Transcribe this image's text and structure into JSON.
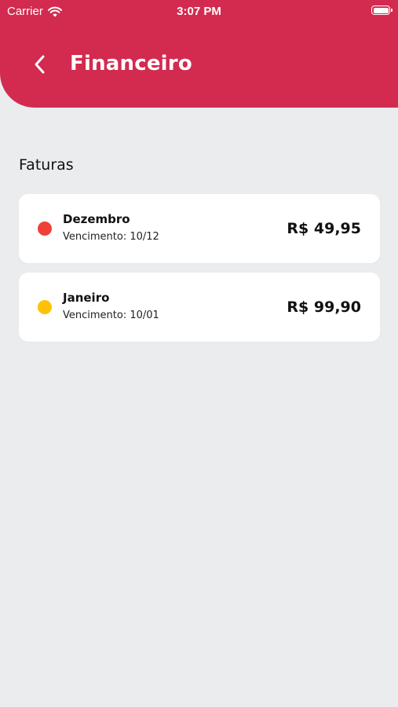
{
  "status_bar": {
    "carrier": "Carrier",
    "time": "3:07 PM"
  },
  "header": {
    "title": "Financeiro",
    "back_icon": "chevron-left-icon",
    "color": "#D22B4F"
  },
  "section": {
    "title": "Faturas"
  },
  "invoices": [
    {
      "month": "Dezembro",
      "due": "Vencimento: 10/12",
      "amount": "R$ 49,95",
      "status_color": "#EE4236"
    },
    {
      "month": "Janeiro",
      "due": "Vencimento: 10/01",
      "amount": "R$ 99,90",
      "status_color": "#FFC107"
    }
  ]
}
